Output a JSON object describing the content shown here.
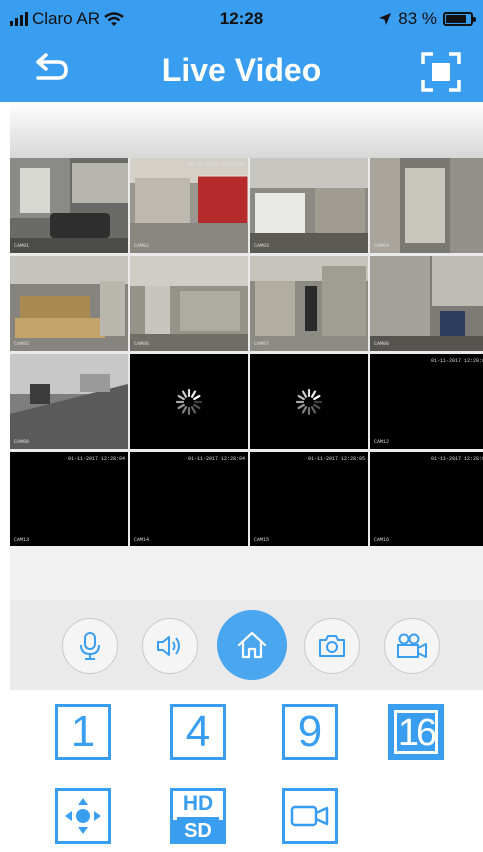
{
  "status_bar": {
    "carrier": "Claro AR",
    "time": "12:28",
    "battery": "83 %",
    "battery_level": 0.83
  },
  "nav": {
    "title": "Live Video"
  },
  "cameras": [
    {
      "ts": "",
      "cam": "CAM01",
      "scene": "outdoor"
    },
    {
      "ts": "01-11-2017 12:28:04",
      "cam": "CAM02",
      "scene": "yard"
    },
    {
      "ts": "",
      "cam": "CAM03",
      "scene": "store"
    },
    {
      "ts": "",
      "cam": "CAM04",
      "scene": "aisle"
    },
    {
      "ts": "",
      "cam": "CAM05",
      "scene": "workshop"
    },
    {
      "ts": "",
      "cam": "CAM06",
      "scene": "hall"
    },
    {
      "ts": "",
      "cam": "CAM07",
      "scene": "shop"
    },
    {
      "ts": "",
      "cam": "CAM08",
      "scene": "counter"
    },
    {
      "ts": "",
      "cam": "CAM09",
      "scene": "street"
    },
    {
      "ts": "",
      "cam": "",
      "scene": "loading"
    },
    {
      "ts": "",
      "cam": "",
      "scene": "loading"
    },
    {
      "ts": "01-11-2017 12:28:0",
      "cam": "CAM12",
      "scene": "black"
    },
    {
      "ts": "01-11-2017 12:28:04",
      "cam": "CAM13",
      "scene": "black"
    },
    {
      "ts": "01-11-2017 12:28:04",
      "cam": "CAM14",
      "scene": "black"
    },
    {
      "ts": "01-11-2017 12:28:05",
      "cam": "CAM15",
      "scene": "black"
    },
    {
      "ts": "01-11-2017 12:28:0",
      "cam": "CAM16",
      "scene": "black"
    }
  ],
  "layouts": {
    "one": "1",
    "four": "4",
    "nine": "9",
    "sixteen": "16"
  },
  "quality": {
    "hd": "HD",
    "sd": "SD"
  },
  "colors": {
    "accent": "#3a9ef0",
    "home": "#4aa6ef"
  }
}
